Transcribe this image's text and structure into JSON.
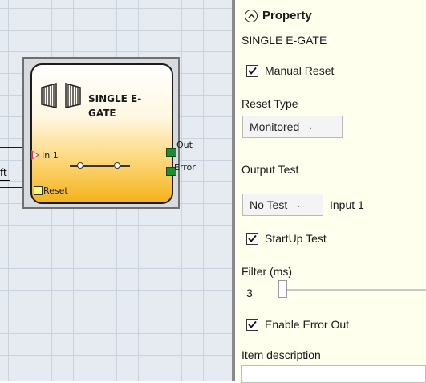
{
  "block": {
    "title": "SINGLE E-GATE",
    "title_line1": "SINGLE E-",
    "title_line2": "GATE",
    "input_pin": "In 1",
    "reset_pin": "Reset",
    "out_pin": "Out",
    "error_pin": "Error",
    "left_fragment": "ft"
  },
  "panel": {
    "header": "Property",
    "block_name": "SINGLE E-GATE",
    "manual_reset": {
      "label": "Manual Reset",
      "checked": true
    },
    "reset_type": {
      "label": "Reset Type",
      "value": "Monitored"
    },
    "output_test": {
      "label": "Output Test"
    },
    "test_select": {
      "value": "No Test",
      "suffix": "Input 1"
    },
    "startup_test": {
      "label": "StartUp Test",
      "checked": true
    },
    "filter": {
      "label": "Filter (ms)",
      "value": "3"
    },
    "enable_error_out": {
      "label": "Enable Error Out",
      "checked": true
    },
    "item_description": {
      "label": "Item description",
      "value": ""
    }
  },
  "colors": {
    "panel_bg": "#ffffee",
    "canvas_bg": "#e6ebf1",
    "block_bottom": "#f4b21a",
    "output_pin": "#1e8a32",
    "input_pin": "#e8343c",
    "reset_pin": "#fffb7a"
  },
  "icons": {
    "collapse": "chevron-up-circle-icon",
    "gate": "gate-icon",
    "check": "checkmark-icon",
    "dropdown": "chevron-down-icon"
  }
}
